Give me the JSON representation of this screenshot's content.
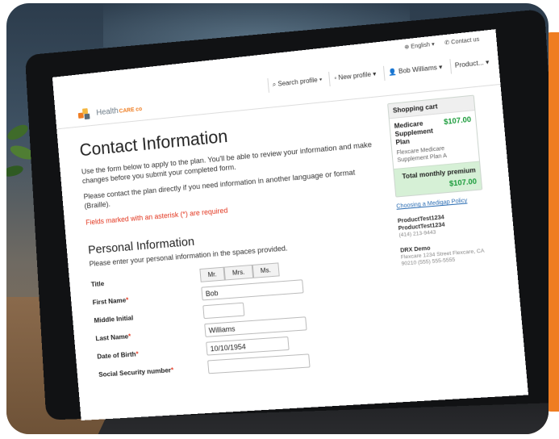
{
  "colors": {
    "accent_orange": "#ef7d22",
    "required_red": "#e2341d",
    "price_green": "#1a9b3a",
    "link_blue": "#2b6db3"
  },
  "topbar": {
    "language": "English",
    "contact": "Contact us"
  },
  "brand": {
    "name": "Health",
    "suffix": "CARE co"
  },
  "nav": {
    "search": "Search profile",
    "new_profile": "New profile",
    "user": "Bob Williams",
    "product": "Product..."
  },
  "main": {
    "title": "Contact Information",
    "intro": "Use the form below to apply to the plan. You'll be able to review your information and make changes before you submit your completed form.",
    "language_note": "Please contact the plan directly if you need information in another language or format (Braille).",
    "required_note": "Fields marked with an asterisk (*) are required"
  },
  "personal": {
    "heading": "Personal Information",
    "instructions": "Please enter your personal information in the spaces provided.",
    "title_label": "Title",
    "title_options": [
      "Mr.",
      "Mrs.",
      "Ms."
    ],
    "first_name_label": "First Name",
    "first_name": "Bob",
    "middle_initial_label": "Middle Initial",
    "middle_initial": "",
    "last_name_label": "Last Name",
    "last_name": "Williams",
    "dob_label": "Date of Birth",
    "dob": "10/10/1954",
    "ssn_label": "Social Security number",
    "ssn": "",
    "asterisk": "*"
  },
  "cart": {
    "heading": "Shopping cart",
    "plan_name": "Medicare Supplement Plan",
    "plan_price": "$107.00",
    "plan_detail": "Flexcare Medicare Supplement Plan A",
    "total_label": "Total monthly premium",
    "total_price": "$107.00"
  },
  "sidebar": {
    "link": "Choosing a Medigap Policy",
    "agent1_name": "ProductTest1234 ProductTest1234",
    "agent1_phone": "(414) 213-9443",
    "agent2_name": "DRX Demo",
    "agent2_address": "Flexcare 1234 Street Flexcare, CA 90210 (555) 555-5555"
  }
}
